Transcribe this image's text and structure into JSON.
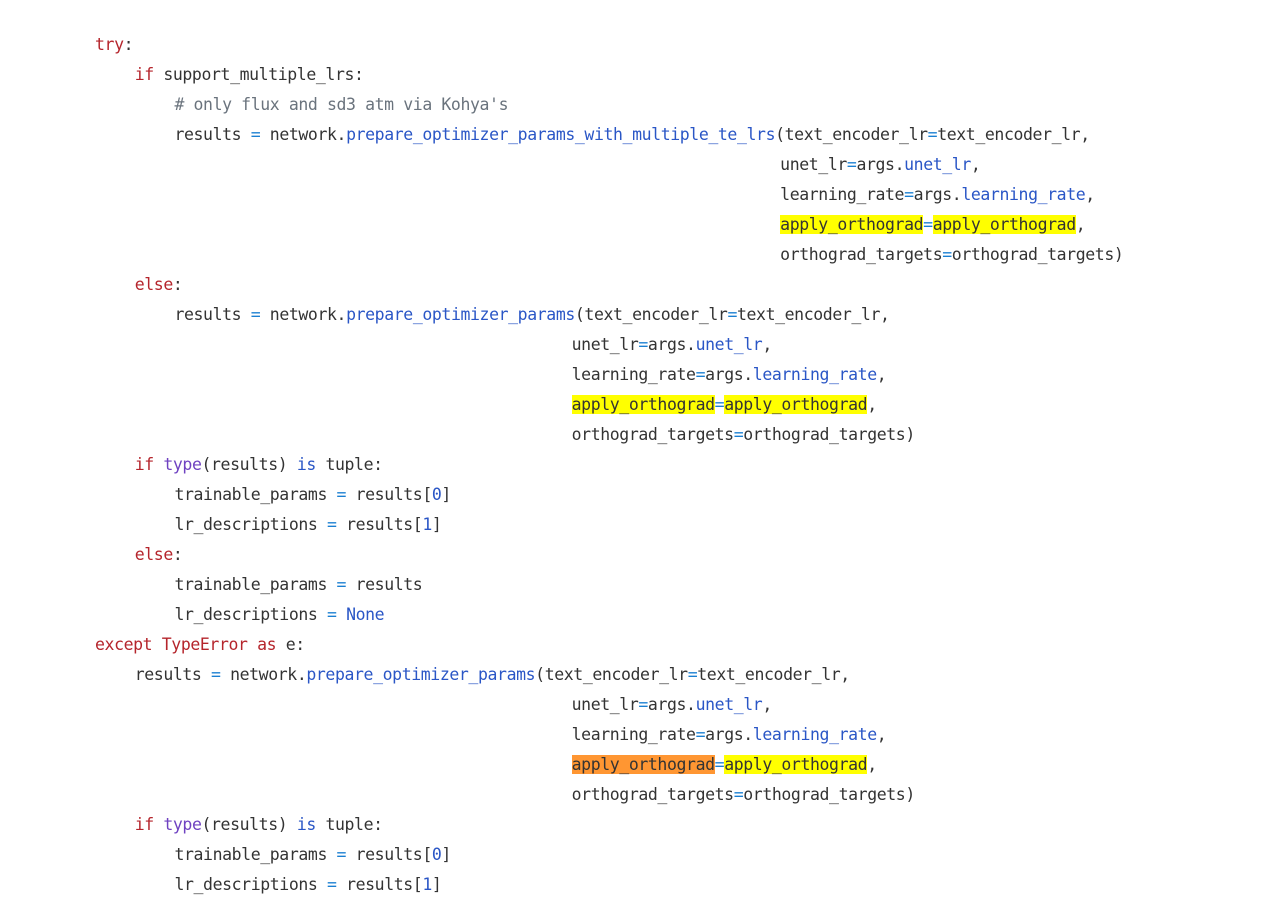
{
  "code": {
    "language": "python",
    "lines": [
      {
        "indent": 0,
        "tokens": [
          {
            "t": "try",
            "c": "kw"
          },
          {
            "t": ":",
            "c": "plain"
          }
        ]
      },
      {
        "indent": 1,
        "tokens": [
          {
            "t": "if",
            "c": "kw"
          },
          {
            "t": " support_multiple_lrs:",
            "c": "plain"
          }
        ]
      },
      {
        "indent": 2,
        "tokens": [
          {
            "t": "# only flux and sd3 atm via Kohya's",
            "c": "comment"
          }
        ]
      },
      {
        "indent": 2,
        "tokens": [
          {
            "t": "results ",
            "c": "plain"
          },
          {
            "t": "=",
            "c": "op"
          },
          {
            "t": " network.",
            "c": "plain"
          },
          {
            "t": "prepare_optimizer_params_with_multiple_te_lrs",
            "c": "blue"
          },
          {
            "t": "(text_encoder_lr",
            "c": "plain"
          },
          {
            "t": "=",
            "c": "op"
          },
          {
            "t": "text_encoder_lr,",
            "c": "plain"
          }
        ]
      },
      {
        "indent": 2,
        "align": 69,
        "tokens": [
          {
            "t": "unet_lr",
            "c": "plain"
          },
          {
            "t": "=",
            "c": "op"
          },
          {
            "t": "args.",
            "c": "plain"
          },
          {
            "t": "unet_lr",
            "c": "blue"
          },
          {
            "t": ",",
            "c": "plain"
          }
        ]
      },
      {
        "indent": 2,
        "align": 69,
        "tokens": [
          {
            "t": "learning_rate",
            "c": "plain"
          },
          {
            "t": "=",
            "c": "op"
          },
          {
            "t": "args.",
            "c": "plain"
          },
          {
            "t": "learning_rate",
            "c": "blue"
          },
          {
            "t": ",",
            "c": "plain"
          }
        ]
      },
      {
        "indent": 2,
        "align": 69,
        "tokens": [
          {
            "t": "apply_orthograd",
            "c": "plain",
            "hl": "yellow"
          },
          {
            "t": "=",
            "c": "op"
          },
          {
            "t": "apply_orthograd",
            "c": "plain",
            "hl": "yellow"
          },
          {
            "t": ",",
            "c": "plain"
          }
        ]
      },
      {
        "indent": 2,
        "align": 69,
        "tokens": [
          {
            "t": "orthograd_targets",
            "c": "plain"
          },
          {
            "t": "=",
            "c": "op"
          },
          {
            "t": "orthograd_targets)",
            "c": "plain"
          }
        ]
      },
      {
        "indent": 1,
        "tokens": [
          {
            "t": "else",
            "c": "kw"
          },
          {
            "t": ":",
            "c": "plain"
          }
        ]
      },
      {
        "indent": 2,
        "tokens": [
          {
            "t": "results ",
            "c": "plain"
          },
          {
            "t": "=",
            "c": "op"
          },
          {
            "t": " network.",
            "c": "plain"
          },
          {
            "t": "prepare_optimizer_params",
            "c": "blue"
          },
          {
            "t": "(text_encoder_lr",
            "c": "plain"
          },
          {
            "t": "=",
            "c": "op"
          },
          {
            "t": "text_encoder_lr,",
            "c": "plain"
          }
        ]
      },
      {
        "indent": 2,
        "align": 48,
        "tokens": [
          {
            "t": "unet_lr",
            "c": "plain"
          },
          {
            "t": "=",
            "c": "op"
          },
          {
            "t": "args.",
            "c": "plain"
          },
          {
            "t": "unet_lr",
            "c": "blue"
          },
          {
            "t": ",",
            "c": "plain"
          }
        ]
      },
      {
        "indent": 2,
        "align": 48,
        "tokens": [
          {
            "t": "learning_rate",
            "c": "plain"
          },
          {
            "t": "=",
            "c": "op"
          },
          {
            "t": "args.",
            "c": "plain"
          },
          {
            "t": "learning_rate",
            "c": "blue"
          },
          {
            "t": ",",
            "c": "plain"
          }
        ]
      },
      {
        "indent": 2,
        "align": 48,
        "tokens": [
          {
            "t": "apply_orthograd",
            "c": "plain",
            "hl": "yellow"
          },
          {
            "t": "=",
            "c": "op"
          },
          {
            "t": "apply_orthograd",
            "c": "plain",
            "hl": "yellow"
          },
          {
            "t": ",",
            "c": "plain"
          }
        ]
      },
      {
        "indent": 2,
        "align": 48,
        "tokens": [
          {
            "t": "orthograd_targets",
            "c": "plain"
          },
          {
            "t": "=",
            "c": "op"
          },
          {
            "t": "orthograd_targets)",
            "c": "plain"
          }
        ]
      },
      {
        "indent": 1,
        "tokens": [
          {
            "t": "if",
            "c": "kw"
          },
          {
            "t": " ",
            "c": "plain"
          },
          {
            "t": "type",
            "c": "purple"
          },
          {
            "t": "(results) ",
            "c": "plain"
          },
          {
            "t": "is",
            "c": "blue"
          },
          {
            "t": " tuple:",
            "c": "plain"
          }
        ]
      },
      {
        "indent": 2,
        "tokens": [
          {
            "t": "trainable_params ",
            "c": "plain"
          },
          {
            "t": "=",
            "c": "op"
          },
          {
            "t": " results[",
            "c": "plain"
          },
          {
            "t": "0",
            "c": "blue"
          },
          {
            "t": "]",
            "c": "plain"
          }
        ]
      },
      {
        "indent": 2,
        "tokens": [
          {
            "t": "lr_descriptions ",
            "c": "plain"
          },
          {
            "t": "=",
            "c": "op"
          },
          {
            "t": " results[",
            "c": "plain"
          },
          {
            "t": "1",
            "c": "blue"
          },
          {
            "t": "]",
            "c": "plain"
          }
        ]
      },
      {
        "indent": 1,
        "tokens": [
          {
            "t": "else",
            "c": "kw"
          },
          {
            "t": ":",
            "c": "plain"
          }
        ]
      },
      {
        "indent": 2,
        "tokens": [
          {
            "t": "trainable_params ",
            "c": "plain"
          },
          {
            "t": "=",
            "c": "op"
          },
          {
            "t": " results",
            "c": "plain"
          }
        ]
      },
      {
        "indent": 2,
        "tokens": [
          {
            "t": "lr_descriptions ",
            "c": "plain"
          },
          {
            "t": "=",
            "c": "op"
          },
          {
            "t": " ",
            "c": "plain"
          },
          {
            "t": "None",
            "c": "blue"
          }
        ]
      },
      {
        "indent": 0,
        "tokens": [
          {
            "t": "except",
            "c": "kw"
          },
          {
            "t": " ",
            "c": "plain"
          },
          {
            "t": "TypeError",
            "c": "kw"
          },
          {
            "t": " ",
            "c": "plain"
          },
          {
            "t": "as",
            "c": "kw"
          },
          {
            "t": " e:",
            "c": "plain"
          }
        ]
      },
      {
        "indent": 1,
        "tokens": [
          {
            "t": "results ",
            "c": "plain"
          },
          {
            "t": "=",
            "c": "op"
          },
          {
            "t": " network.",
            "c": "plain"
          },
          {
            "t": "prepare_optimizer_params",
            "c": "blue"
          },
          {
            "t": "(text_encoder_lr",
            "c": "plain"
          },
          {
            "t": "=",
            "c": "op"
          },
          {
            "t": "text_encoder_lr,",
            "c": "plain"
          }
        ]
      },
      {
        "indent": 1,
        "align": 48,
        "tokens": [
          {
            "t": "unet_lr",
            "c": "plain"
          },
          {
            "t": "=",
            "c": "op"
          },
          {
            "t": "args.",
            "c": "plain"
          },
          {
            "t": "unet_lr",
            "c": "blue"
          },
          {
            "t": ",",
            "c": "plain"
          }
        ]
      },
      {
        "indent": 1,
        "align": 48,
        "tokens": [
          {
            "t": "learning_rate",
            "c": "plain"
          },
          {
            "t": "=",
            "c": "op"
          },
          {
            "t": "args.",
            "c": "plain"
          },
          {
            "t": "learning_rate",
            "c": "blue"
          },
          {
            "t": ",",
            "c": "plain"
          }
        ]
      },
      {
        "indent": 1,
        "align": 48,
        "tokens": [
          {
            "t": "apply_orthograd",
            "c": "plain",
            "hl": "orange"
          },
          {
            "t": "=",
            "c": "op"
          },
          {
            "t": "apply_orthograd",
            "c": "plain",
            "hl": "yellow"
          },
          {
            "t": ",",
            "c": "plain"
          }
        ]
      },
      {
        "indent": 1,
        "align": 48,
        "tokens": [
          {
            "t": "orthograd_targets",
            "c": "plain"
          },
          {
            "t": "=",
            "c": "op"
          },
          {
            "t": "orthograd_targets)",
            "c": "plain"
          }
        ]
      },
      {
        "indent": 1,
        "tokens": [
          {
            "t": "if",
            "c": "kw"
          },
          {
            "t": " ",
            "c": "plain"
          },
          {
            "t": "type",
            "c": "purple"
          },
          {
            "t": "(results) ",
            "c": "plain"
          },
          {
            "t": "is",
            "c": "blue"
          },
          {
            "t": " tuple:",
            "c": "plain"
          }
        ]
      },
      {
        "indent": 2,
        "tokens": [
          {
            "t": "trainable_params ",
            "c": "plain"
          },
          {
            "t": "=",
            "c": "op"
          },
          {
            "t": " results[",
            "c": "plain"
          },
          {
            "t": "0",
            "c": "blue"
          },
          {
            "t": "]",
            "c": "plain"
          }
        ]
      },
      {
        "indent": 2,
        "tokens": [
          {
            "t": "lr_descriptions ",
            "c": "plain"
          },
          {
            "t": "=",
            "c": "op"
          },
          {
            "t": " results[",
            "c": "plain"
          },
          {
            "t": "1",
            "c": "blue"
          },
          {
            "t": "]",
            "c": "plain"
          }
        ]
      }
    ]
  },
  "colors": {
    "keyword": "#b5252c",
    "function": "#2a56c6",
    "builtin": "#6f42c1",
    "operator": "#1a7fd2",
    "comment": "#6a737d",
    "text": "#333333",
    "highlight_match": "#ffff00",
    "highlight_current": "#ff9632"
  }
}
